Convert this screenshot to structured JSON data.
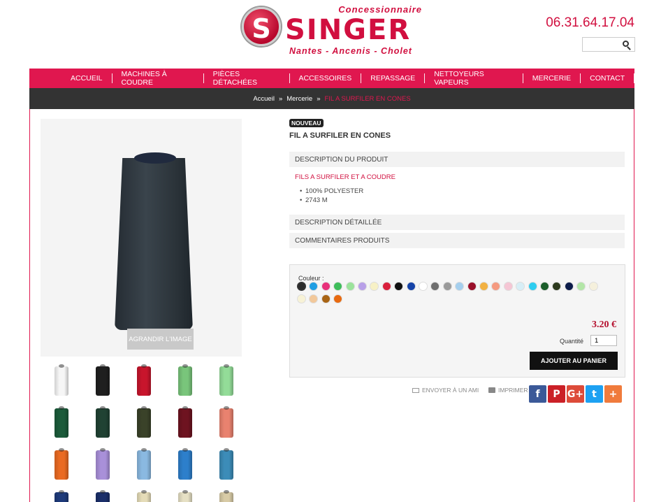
{
  "logo": {
    "dealer": "Concessionnaire",
    "mark": "S",
    "brand": "SINGER",
    "cities": "Nantes - Ancenis - Cholet"
  },
  "header": {
    "phone": "06.31.64.17.04",
    "search_placeholder": ""
  },
  "nav": [
    "ACCUEIL",
    "MACHINES À COUDRE",
    "PIÈCES DÉTACHÉES",
    "ACCESSOIRES",
    "REPASSAGE",
    "NETTOYEURS VAPEURS",
    "MERCERIE",
    "CONTACT"
  ],
  "breadcrumb": {
    "home": "Accueil",
    "sep": "»",
    "category": "Mercerie",
    "current": "FIL A SURFILER EN CONES"
  },
  "product": {
    "badge": "NOUVEAU",
    "title": "FIL A SURFILER EN CONES",
    "zoom_label": "AGRANDIR L'IMAGE",
    "desc_tab": "DESCRIPTION DU PRODUIT",
    "short_heading": "FILS A SURFILER ET A COUDRE",
    "features": [
      "100% POLYESTER",
      "2743 M"
    ],
    "detail_tab": "DESCRIPTION DÉTAILLÉE",
    "reviews_tab": "COMMENTAIRES PRODUITS",
    "color_label": "Couleur :",
    "price": "3.20 €",
    "qty_label": "Quantité",
    "qty_value": "1",
    "cart_label": "AJOUTER AU PANIER",
    "send_friend": "ENVOYER À UN AMI",
    "print": "IMPRIMER"
  },
  "swatches": [
    "#2b2b2b",
    "#1f9ee3",
    "#e8307a",
    "#3dbd5a",
    "#9be39b",
    "#b8a0e8",
    "#f7f1c6",
    "#d9203c",
    "#111111",
    "#1543a8",
    "#ffffff",
    "#6e6e6e",
    "#9a9a9a",
    "#a5cfee",
    "#9a0f2a",
    "#f2b142",
    "#f59a80",
    "#f5c6d4",
    "#d7eef6",
    "#2ecdf0",
    "#1b5e2a",
    "#2d3a1e",
    "#0c1c4a",
    "#b3e6a8",
    "#f5f0dc",
    "#f7f2d6",
    "#f2c89a",
    "#a86414",
    "#e86a10"
  ],
  "thumbnails": [
    "#f6f6f6",
    "#1f1f1f",
    "#c8152c",
    "#79c57b",
    "#93dc98",
    "#1b5b3a",
    "#204233",
    "#3a4229",
    "#6e1320",
    "#e9826f",
    "#ea6a22",
    "#a990d9",
    "#8ab9e1",
    "#2d7fcb",
    "#3c8cb8",
    "#1e3a7a",
    "#1b2f6a",
    "#e5dcb8",
    "#e6e0c4",
    "#d8cba6"
  ],
  "social": [
    {
      "name": "facebook",
      "glyph": "f",
      "color": "#3b5998"
    },
    {
      "name": "pinterest",
      "glyph": "P",
      "color": "#cb2027"
    },
    {
      "name": "google-plus",
      "glyph": "G+",
      "color": "#dd4b39"
    },
    {
      "name": "twitter",
      "glyph": "t",
      "color": "#1da1f2"
    },
    {
      "name": "share",
      "glyph": "+",
      "color": "#f07b3c"
    }
  ]
}
